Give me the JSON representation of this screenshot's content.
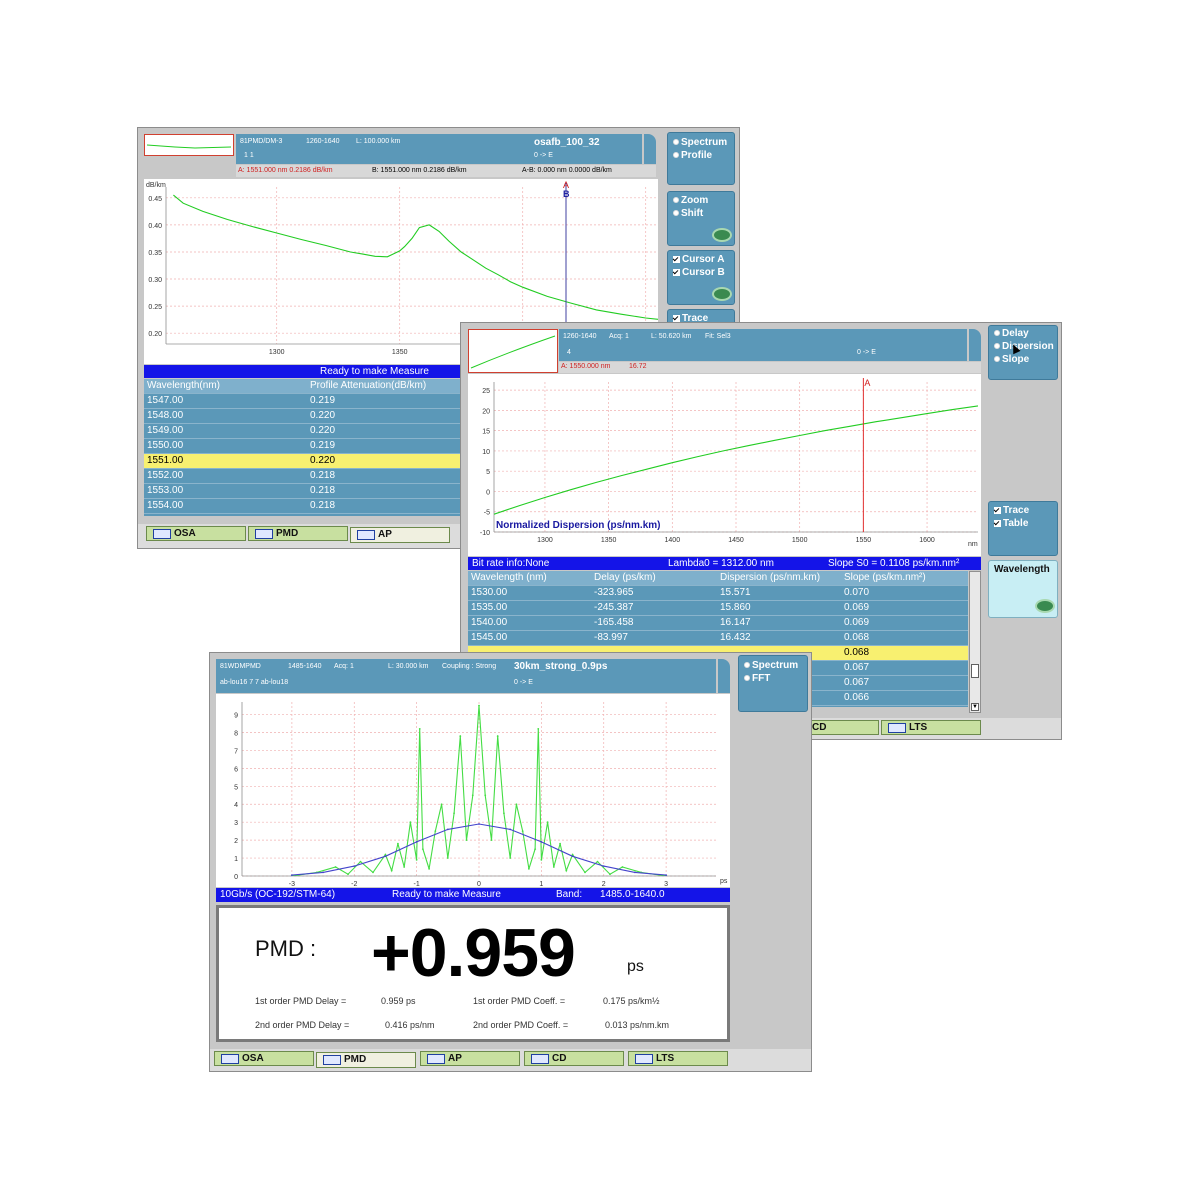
{
  "ap_window": {
    "header": {
      "module": "81PMD/DM-3",
      "range": "1260-1640",
      "length": "L: 100.000 km",
      "file": "osafb_100_32",
      "counters": "1   1",
      "direction": "0 -> E"
    },
    "cursor_info": {
      "a": "A: 1551.000 nm    0.2186 dB/km",
      "b": "B: 1551.000 nm    0.2186 dB/km",
      "ab": "A-B: 0.000 nm   0.0000 dB/km"
    },
    "status": "Ready to make Measure",
    "table_headers": [
      "Wavelength(nm)",
      "Profile Attenuation(dB/km)"
    ],
    "rows": [
      [
        "1547.00",
        "0.219"
      ],
      [
        "1548.00",
        "0.220"
      ],
      [
        "1549.00",
        "0.220"
      ],
      [
        "1550.00",
        "0.219"
      ],
      [
        "1551.00",
        "0.220"
      ],
      [
        "1552.00",
        "0.218"
      ],
      [
        "1553.00",
        "0.218"
      ],
      [
        "1554.00",
        "0.218"
      ]
    ],
    "selected_row": 4,
    "side_buttons": {
      "spectrum": "Spectrum",
      "profile": "Profile",
      "zoom": "Zoom",
      "shift": "Shift",
      "cursor_a": "Cursor A",
      "cursor_b": "Cursor B",
      "trace": "Trace"
    },
    "tabs": [
      "OSA",
      "PMD",
      "AP"
    ],
    "active_tab": 2,
    "chart": {
      "ylabel": "dB/km",
      "cursor_a": "A",
      "cursor_b": "B"
    }
  },
  "cd_window": {
    "header": {
      "range": "1260-1640",
      "acq": "Acq: 1",
      "length": "L: 50.620 km",
      "fit": "Fit: Sel3",
      "count": "4",
      "direction": "0 -> E"
    },
    "cursor_info": {
      "a": "A: 1550.000 nm",
      "value": "16.72"
    },
    "status": {
      "bitrate": "Bit rate info:None",
      "lambda0": "Lambda0 = 1312.00 nm",
      "slope": "Slope S0 = 0.1108  ps/km.nm²"
    },
    "table_headers": [
      "Wavelength (nm)",
      "Delay (ps/km)",
      "Dispersion (ps/nm.km)",
      "Slope (ps/km.nm²)"
    ],
    "rows": [
      [
        "1530.00",
        "-323.965",
        "15.571",
        "0.070"
      ],
      [
        "1535.00",
        "-245.387",
        "15.860",
        "0.069"
      ],
      [
        "1540.00",
        "-165.458",
        "16.147",
        "0.069"
      ],
      [
        "1545.00",
        "-83.997",
        "16.432",
        "0.068"
      ],
      [
        "",
        "",
        "",
        "0.068"
      ],
      [
        "",
        "",
        "",
        "0.067"
      ],
      [
        "",
        "",
        "",
        "0.067"
      ],
      [
        "",
        "",
        "",
        "0.066"
      ]
    ],
    "selected_row": 4,
    "side_buttons": {
      "delay": "Delay",
      "dispersion": "Dispersion",
      "slope": "Slope",
      "trace": "Trace",
      "table": "Table",
      "wavelength": "Wavelength"
    },
    "tabs": [
      "CD",
      "LTS"
    ],
    "chart": {
      "annotation": "Normalized Dispersion (ps/nm.km)",
      "xunit": "nm",
      "cursor_a": "A"
    }
  },
  "pmd_window": {
    "header": {
      "module": "81WDMPMD",
      "range": "1485-1640",
      "acq": "Acq: 1",
      "length": "L: 30.000 km",
      "coupling": "Coupling : Strong",
      "file": "30km_strong_0.9ps",
      "ids": "ab-lou16  7  7  ab-lou18",
      "direction": "0 -> E"
    },
    "status": {
      "rate": "10Gb/s (OC-192/STM-64)",
      "message": "Ready to make Measure",
      "band_label": "Band:",
      "band": "1485.0-1640.0"
    },
    "result": {
      "label": "PMD :",
      "value": "+0.959",
      "unit": "ps",
      "d1_label": "1st order PMD Delay =",
      "d1_value": "0.959 ps",
      "c1_label": "1st order PMD Coeff. =",
      "c1_value": "0.175 ps/km½",
      "d2_label": "2nd order PMD Delay =",
      "d2_value": "0.416 ps/nm",
      "c2_label": "2nd order PMD Coeff. =",
      "c2_value": "0.013 ps/nm.km"
    },
    "side_buttons": {
      "spectrum": "Spectrum",
      "fft": "FFT"
    },
    "tabs": [
      "OSA",
      "PMD",
      "AP",
      "CD",
      "LTS"
    ],
    "active_tab": 1,
    "chart": {
      "xunit": "ps"
    }
  },
  "chart_data": [
    {
      "type": "line",
      "name_hint": "attenuation profile",
      "ylabel": "dB/km",
      "xlim": [
        1255,
        1455
      ],
      "ylim": [
        0.18,
        0.47
      ],
      "xticks": [
        1300,
        1350,
        1400,
        1450
      ],
      "yticks": [
        0.2,
        0.25,
        0.3,
        0.35,
        0.4,
        0.45
      ],
      "yticklabels": [
        "0.20",
        "0.25",
        "0.30",
        "0.35",
        "0.40",
        "0.45"
      ],
      "series": [
        {
          "color": "#22cc22",
          "x": [
            1258,
            1262,
            1270,
            1280,
            1290,
            1300,
            1310,
            1320,
            1330,
            1335,
            1340,
            1345,
            1350,
            1352,
            1355,
            1358,
            1362,
            1366,
            1370,
            1375,
            1380,
            1385,
            1390,
            1395,
            1400,
            1410,
            1420,
            1430,
            1440,
            1450,
            1460,
            1480,
            1500,
            1520,
            1540,
            1560,
            1580,
            1600
          ],
          "y": [
            0.455,
            0.44,
            0.425,
            0.41,
            0.397,
            0.385,
            0.373,
            0.362,
            0.35,
            0.346,
            0.342,
            0.341,
            0.352,
            0.36,
            0.375,
            0.395,
            0.4,
            0.388,
            0.37,
            0.35,
            0.335,
            0.32,
            0.308,
            0.295,
            0.285,
            0.268,
            0.255,
            0.243,
            0.235,
            0.228,
            0.223,
            0.219,
            0.218,
            0.218,
            0.219,
            0.22,
            0.225,
            0.245
          ]
        }
      ],
      "cursor_x": 1551
    },
    {
      "type": "line",
      "name_hint": "chromatic dispersion",
      "title": "Normalized Dispersion (ps/nm.km)",
      "xlabel": "nm",
      "xlim": [
        1260,
        1640
      ],
      "ylim": [
        -10,
        27
      ],
      "xticks": [
        1300,
        1350,
        1400,
        1450,
        1500,
        1550,
        1600
      ],
      "yticks": [
        -10,
        -5,
        0,
        5,
        10,
        15,
        20,
        25
      ],
      "series": [
        {
          "color": "#22cc22",
          "x": [
            1260,
            1280,
            1300,
            1320,
            1340,
            1360,
            1380,
            1400,
            1420,
            1440,
            1460,
            1480,
            1500,
            1520,
            1540,
            1560,
            1580,
            1600,
            1620,
            1640
          ],
          "y": [
            -5.6,
            -3.5,
            -1.5,
            0.4,
            2.2,
            3.9,
            5.5,
            7.1,
            8.6,
            10.0,
            11.3,
            12.6,
            13.8,
            15.0,
            16.1,
            17.2,
            18.2,
            19.2,
            20.2,
            21.1
          ]
        }
      ],
      "cursor_x": 1550
    },
    {
      "type": "line",
      "name_hint": "PMD FFT",
      "xlabel": "ps",
      "xlim": [
        -3.8,
        3.8
      ],
      "ylim": [
        0,
        9.7
      ],
      "xticks": [
        -3,
        -2,
        -1,
        0,
        1,
        2,
        3
      ],
      "yticks": [
        0,
        1,
        2,
        3,
        4,
        5,
        6,
        7,
        8,
        9
      ],
      "series": [
        {
          "color": "#44dd44",
          "x": [
            -3.0,
            -2.6,
            -2.3,
            -2.1,
            -1.9,
            -1.7,
            -1.5,
            -1.4,
            -1.3,
            -1.2,
            -1.1,
            -1.0,
            -0.95,
            -0.9,
            -0.8,
            -0.7,
            -0.6,
            -0.5,
            -0.4,
            -0.3,
            -0.2,
            -0.1,
            0.0,
            0.1,
            0.2,
            0.3,
            0.4,
            0.5,
            0.6,
            0.7,
            0.8,
            0.9,
            0.95,
            1.0,
            1.1,
            1.2,
            1.3,
            1.4,
            1.5,
            1.7,
            1.9,
            2.1,
            2.3,
            2.6,
            3.0
          ],
          "y": [
            0.0,
            0.2,
            0.5,
            0.1,
            0.8,
            0.2,
            1.2,
            0.3,
            1.8,
            0.5,
            3.0,
            0.9,
            8.2,
            1.5,
            0.4,
            2.5,
            4.0,
            1.0,
            3.5,
            7.8,
            2.0,
            4.5,
            9.5,
            4.5,
            2.0,
            7.8,
            3.5,
            1.0,
            4.0,
            2.5,
            0.4,
            1.5,
            8.2,
            0.9,
            3.0,
            0.5,
            1.8,
            0.3,
            1.2,
            0.2,
            0.8,
            0.1,
            0.5,
            0.2,
            0.0
          ]
        },
        {
          "color": "#4444cc",
          "x": [
            -3.0,
            -2.5,
            -2.0,
            -1.5,
            -1.0,
            -0.5,
            0.0,
            0.5,
            1.0,
            1.5,
            2.0,
            2.5,
            3.0
          ],
          "y": [
            0.05,
            0.2,
            0.55,
            1.1,
            1.9,
            2.6,
            2.9,
            2.6,
            1.9,
            1.1,
            0.55,
            0.2,
            0.05
          ]
        }
      ]
    }
  ]
}
